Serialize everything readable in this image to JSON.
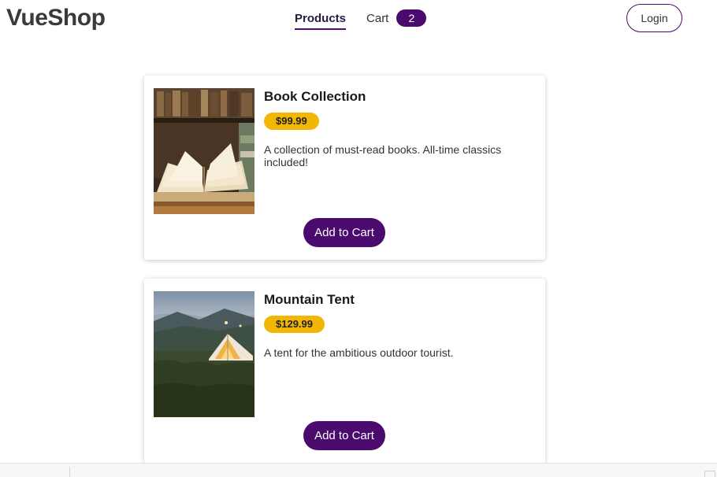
{
  "header": {
    "brand": "VueShop",
    "nav": {
      "products": "Products",
      "cart": "Cart",
      "cart_count": "2"
    },
    "login_label": "Login"
  },
  "products": [
    {
      "title": "Book Collection",
      "price": "$99.99",
      "description": "A collection of must-read books. All-time classics included!",
      "button": "Add to Cart",
      "image": "open-books-photo"
    },
    {
      "title": "Mountain Tent",
      "price": "$129.99",
      "description": "A tent for the ambitious outdoor tourist.",
      "button": "Add to Cart",
      "image": "glamping-tent-photo"
    }
  ],
  "colors": {
    "accent": "#4b0a6e",
    "price_badge": "#f2b705",
    "brand_text": "#3a3a3a"
  }
}
